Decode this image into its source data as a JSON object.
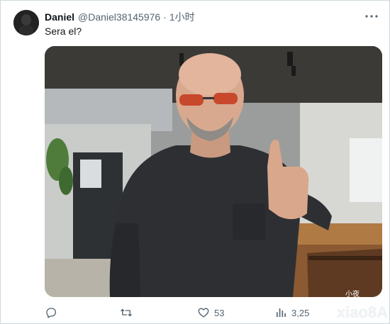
{
  "tweet": {
    "author_name": "Daniel",
    "handle": "@Daniel38145976",
    "separator": "·",
    "time": "1小时",
    "more_label": "···",
    "text": "Sera el?"
  },
  "actions": {
    "reply_count": "",
    "retweet_count": "",
    "like_count": "53",
    "views_count": "3,25"
  },
  "watermark": {
    "label_small": "小夜",
    "label_large": "xiao8A"
  },
  "icons": {
    "reply": "reply-icon",
    "retweet": "retweet-icon",
    "like": "heart-icon",
    "views": "views-icon",
    "more": "more-icon"
  }
}
